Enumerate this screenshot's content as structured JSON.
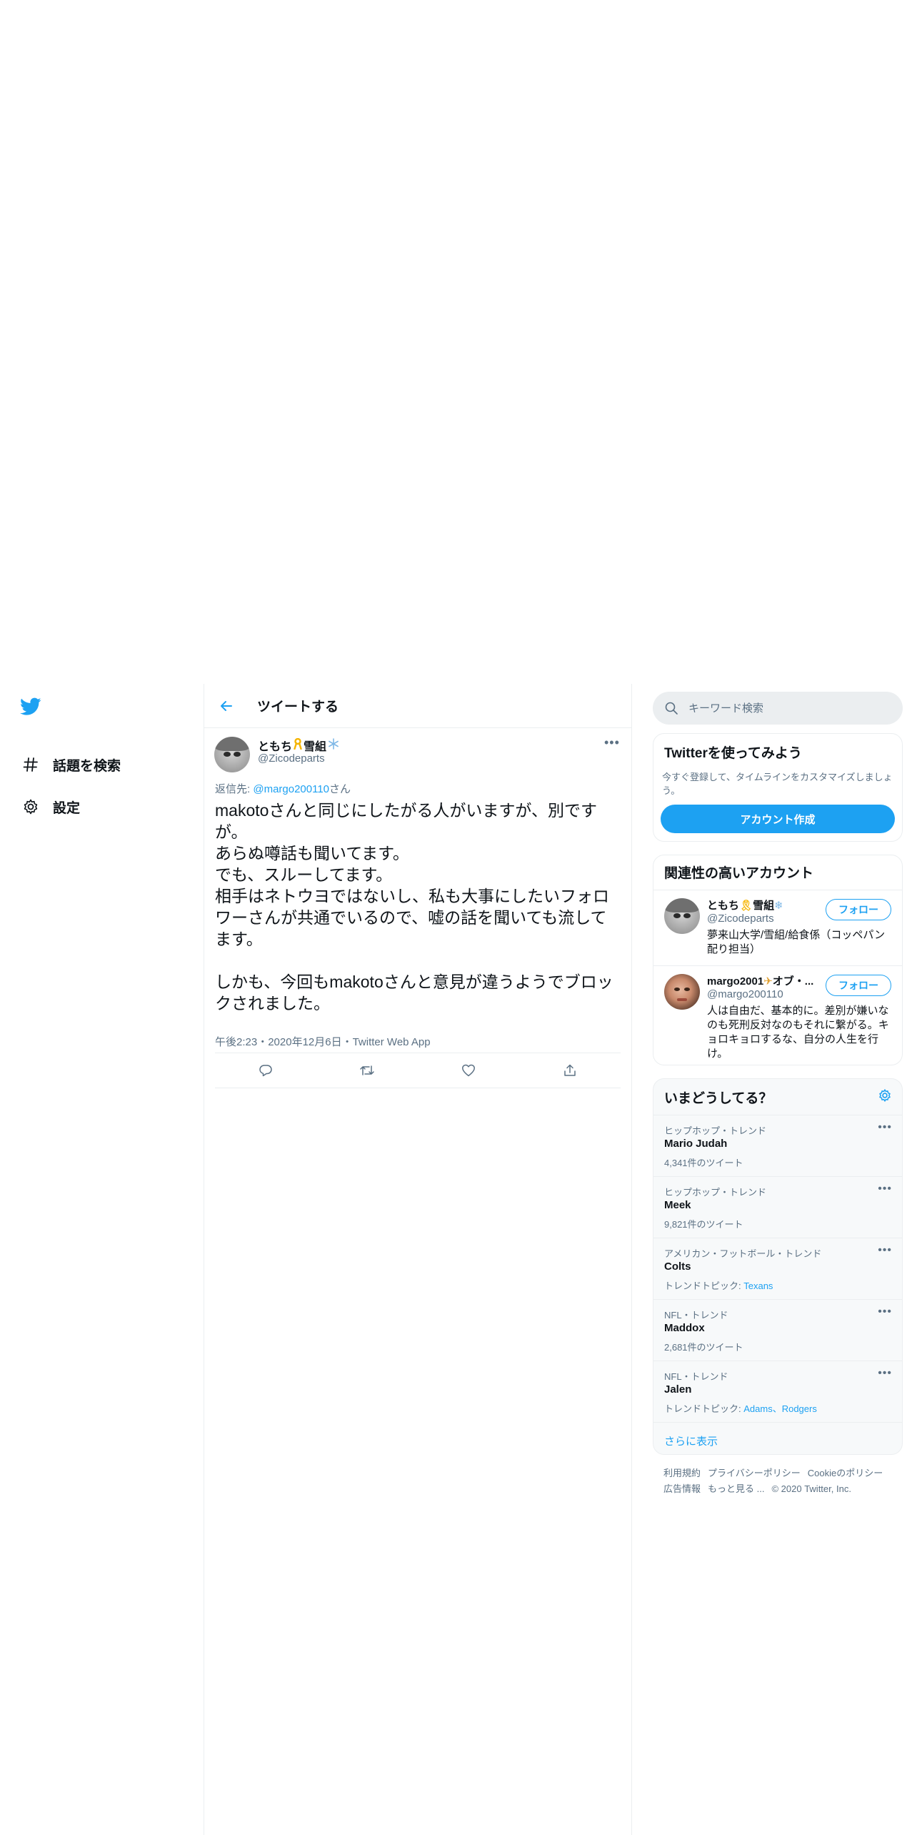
{
  "nav": {
    "items": [
      {
        "label": "話題を検索",
        "icon": "hashtag-icon"
      },
      {
        "label": "設定",
        "icon": "gear-icon"
      }
    ]
  },
  "header": {
    "title": "ツイートする"
  },
  "tweet": {
    "author_name": "ともち",
    "author_suffix": "雪組",
    "author_handle": "@Zicodeparts",
    "reply_prefix": "返信先: ",
    "reply_handle": "@margo200110",
    "reply_suffix": "さん",
    "text": "makotoさんと同じにしたがる人がいますが、別ですが。\nあらぬ噂話も聞いてます。\nでも、スルーしてます。\n相手はネトウヨではないし、私も大事にしたいフォロワーさんが共通でいるので、嘘の話を聞いても流してます。\n\nしかも、今回もmakotoさんと意見が違うようでブロックされました。",
    "meta": "午後2:23・2020年12月6日・Twitter Web App"
  },
  "search": {
    "placeholder": "キーワード検索"
  },
  "signup": {
    "title": "Twitterを使ってみよう",
    "desc": "今すぐ登録して、タイムラインをカスタマイズしましょう。",
    "button": "アカウント作成"
  },
  "who_to_follow": {
    "title": "関連性の高いアカウント",
    "follow_label": "フォロー",
    "accounts": [
      {
        "name": "ともち",
        "name_suffix": "雪組",
        "handle": "@Zicodeparts",
        "bio": "夢来山大学/雪組/給食係（コッペパン配り担当）"
      },
      {
        "name": "margo2001",
        "name_suffix": "オブ・...",
        "handle": "@margo200110",
        "bio": "人は自由だ、基本的に。差別が嫌いなのも死刑反対なのもそれに繋がる。キョロキョロするな、自分の人生を行け。"
      }
    ]
  },
  "trends": {
    "title": "いまどうしてる？",
    "items": [
      {
        "context": "ヒップホップ・トレンド",
        "title": "Mario Judah",
        "count": "4,341件のツイート"
      },
      {
        "context": "ヒップホップ・トレンド",
        "title": "Meek",
        "count": "9,821件のツイート"
      },
      {
        "context": "アメリカン・フットボール・トレンド",
        "title": "Colts",
        "topic_label": "トレンドトピック: ",
        "topics": "Texans"
      },
      {
        "context": "NFL・トレンド",
        "title": "Maddox",
        "count": "2,681件のツイート"
      },
      {
        "context": "NFL・トレンド",
        "title": "Jalen",
        "topic_label": "トレンドトピック: ",
        "topics": "Adams、Rodgers"
      }
    ],
    "show_more": "さらに表示"
  },
  "footer": {
    "links": [
      "利用規約",
      "プライバシーポリシー",
      "Cookieのポリシー",
      "広告情報",
      "もっと見る ..."
    ],
    "copyright": "© 2020 Twitter, Inc."
  },
  "colors": {
    "accent": "#1da1f2",
    "text": "#0f1419",
    "muted": "#5b7083",
    "border": "#ebeef0"
  }
}
